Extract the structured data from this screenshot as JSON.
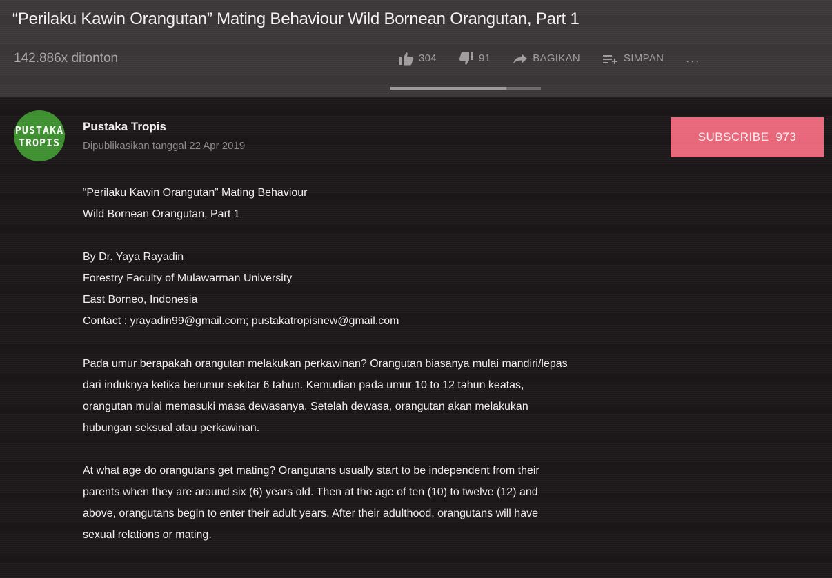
{
  "video": {
    "title": "“Perilaku Kawin Orangutan” Mating Behaviour Wild Bornean Orangutan, Part 1",
    "views": "142.886x ditonton"
  },
  "actions": {
    "likes": "304",
    "dislikes": "91",
    "share_label": "BAGIKAN",
    "save_label": "SIMPAN",
    "more_label": "...",
    "like_ratio": 0.77
  },
  "channel": {
    "name": "Pustaka Tropis",
    "published": "Dipublikasikan tanggal 22 Apr 2019",
    "avatar_text": "PUSTAKA TROPIS"
  },
  "subscribe": {
    "label": "SUBSCRIBE",
    "count": "973"
  },
  "description": {
    "paragraphs": [
      "“Perilaku Kawin Orangutan”  Mating Behaviour\nWild Bornean Orangutan, Part 1",
      "By Dr. Yaya Rayadin\nForestry Faculty of Mulawarman University\nEast Borneo, Indonesia\nContact : yrayadin99@gmail.com; pustakatropisnew@gmail.com",
      "Pada umur berapakah orangutan melakukan perkawinan? Orangutan biasanya mulai mandiri/lepas\ndari induknya ketika berumur sekitar 6 tahun. Kemudian pada umur 10 to 12 tahun keatas,\norangutan mulai memasuki masa dewasanya. Setelah dewasa, orangutan akan melakukan\nhubungan seksual atau perkawinan.",
      "At what age do orangutans get mating? Orangutans usually start to be independent from their\nparents when they are around six (6) years old. Then at the age of ten (10) to twelve (12) and\nabove, orangutans begin to enter their adult years. After their adulthood, orangutans will have\nsexual relations or mating."
    ]
  },
  "colors": {
    "background": "#1b1718",
    "header": "#3a3637",
    "subscribe": "#e8677a",
    "avatar": "#3d8f2f"
  },
  "icons": {
    "like": "thumbs-up-icon",
    "dislike": "thumbs-down-icon",
    "share": "share-arrow-icon",
    "save": "playlist-add-icon"
  }
}
